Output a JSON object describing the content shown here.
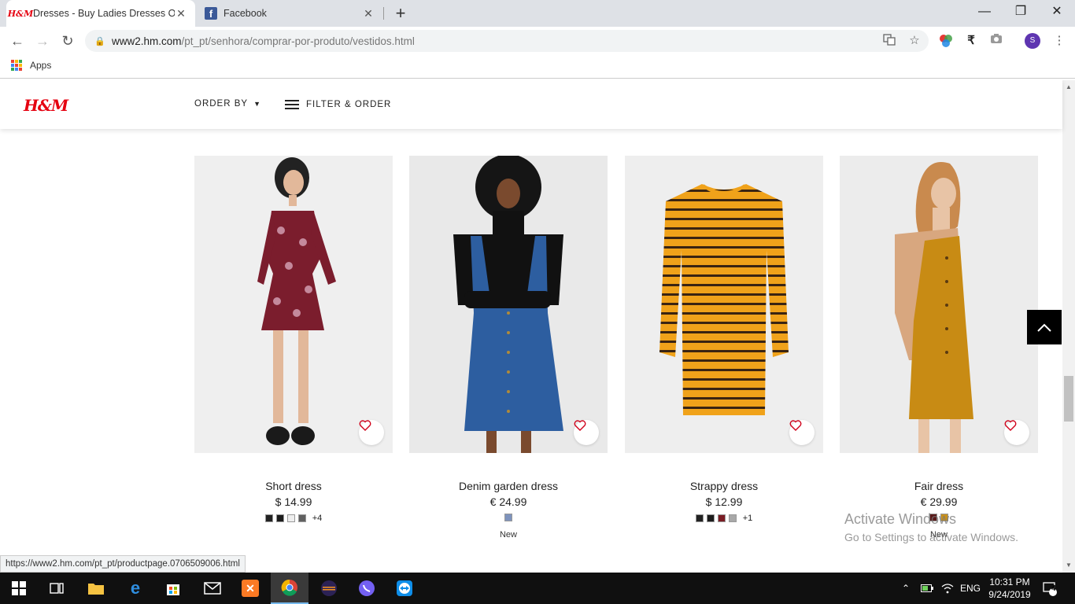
{
  "browser": {
    "tabs": [
      {
        "title": "Dresses - Buy Ladies Dresses Onl",
        "favicon": "hm-favicon",
        "active": true
      },
      {
        "title": "Facebook",
        "favicon": "facebook-favicon",
        "active": false
      }
    ],
    "new_tab": "+",
    "url_host": "www2.hm.com",
    "url_path": "/pt_pt/senhora/comprar-por-produto/vestidos.html",
    "profile_initial": "S",
    "bookmarks": {
      "apps_label": "Apps"
    }
  },
  "header": {
    "logo": "H&M",
    "order_by": "ORDER BY",
    "filter": "FILTER & ORDER"
  },
  "products": [
    {
      "name": "Short dress",
      "price": "$ 14.99",
      "swatches": [
        "#222222",
        "#1c1c1c",
        "#eeeeee",
        "#606060"
      ],
      "more": "+4",
      "badge": ""
    },
    {
      "name": "Denim garden dress",
      "price": "€ 24.99",
      "swatches": [
        "#7e93bd"
      ],
      "more": "",
      "badge": "New"
    },
    {
      "name": "Strappy dress",
      "price": "$ 12.99",
      "swatches": [
        "#222222",
        "#1c1c1c",
        "#7a1c24",
        "#a8a8a8"
      ],
      "more": "+1",
      "badge": ""
    },
    {
      "name": "Fair dress",
      "price": "€ 29.99",
      "swatches": [
        "#5a1a1a",
        "#c8901c"
      ],
      "more": "",
      "badge": "New"
    }
  ],
  "status_url": "https://www2.hm.com/pt_pt/productpage.0706509006.html",
  "watermark": {
    "line1": "Activate Windows",
    "line2": "Go to Settings to activate Windows."
  },
  "taskbar": {
    "language": "ENG",
    "time": "10:31 PM",
    "date": "9/24/2019",
    "notifications": "4"
  },
  "colors": {
    "brand_red": "#e50010",
    "accent": "#000000"
  }
}
